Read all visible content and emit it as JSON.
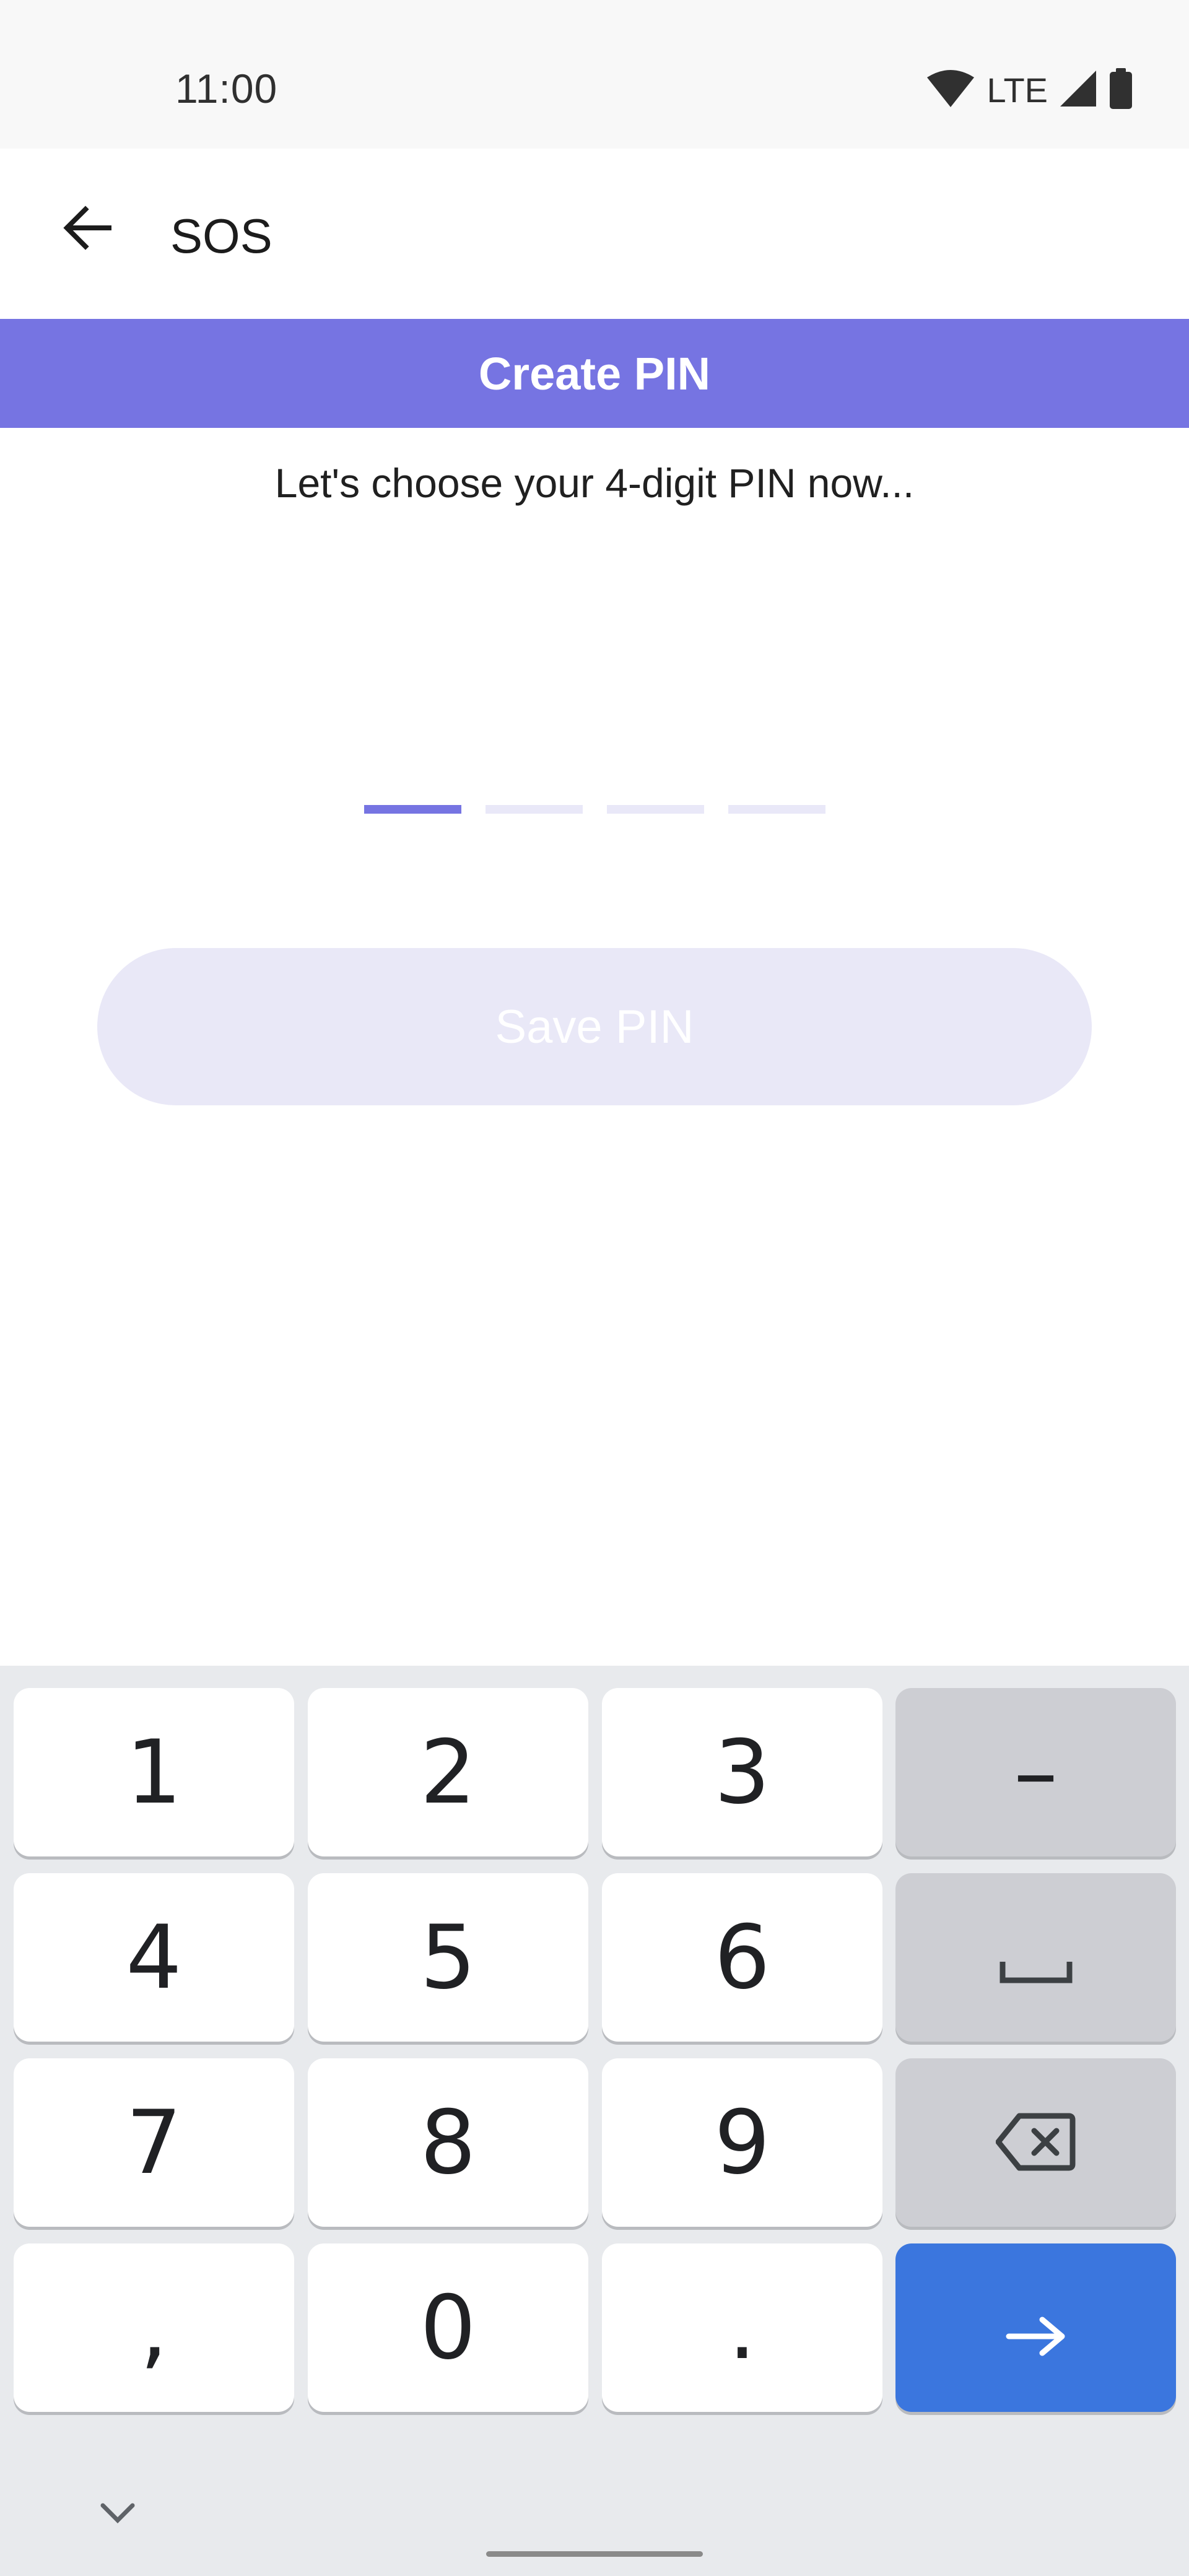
{
  "status_bar": {
    "time": "11:00",
    "network": "LTE",
    "icons": [
      "wifi-icon",
      "cell-signal-icon",
      "battery-icon"
    ]
  },
  "app_bar": {
    "back_icon": "arrow-back-icon",
    "title": "SOS"
  },
  "banner": {
    "title": "Create PIN"
  },
  "instruction": "Let's choose your 4-digit PIN now...",
  "pin_entry": {
    "length": 4,
    "active_index": 0
  },
  "save_button": {
    "label": "Save PIN",
    "enabled": false
  },
  "keyboard": {
    "keys": {
      "k1": "1",
      "k2": "2",
      "k3": "3",
      "dash": "–",
      "k4": "4",
      "k5": "5",
      "k6": "6",
      "k7": "7",
      "k8": "8",
      "k9": "9",
      "comma": ",",
      "k0": "0",
      "period": "."
    },
    "icons": [
      "space-icon",
      "backspace-icon",
      "arrow-forward-icon",
      "chevron-down-icon"
    ]
  },
  "colors": {
    "accent": "#7674e2",
    "accent_light": "#e9e8f7",
    "keyboard_bg": "#e8eaed",
    "key_func": "#cdced3",
    "enter_key": "#3b76de"
  }
}
